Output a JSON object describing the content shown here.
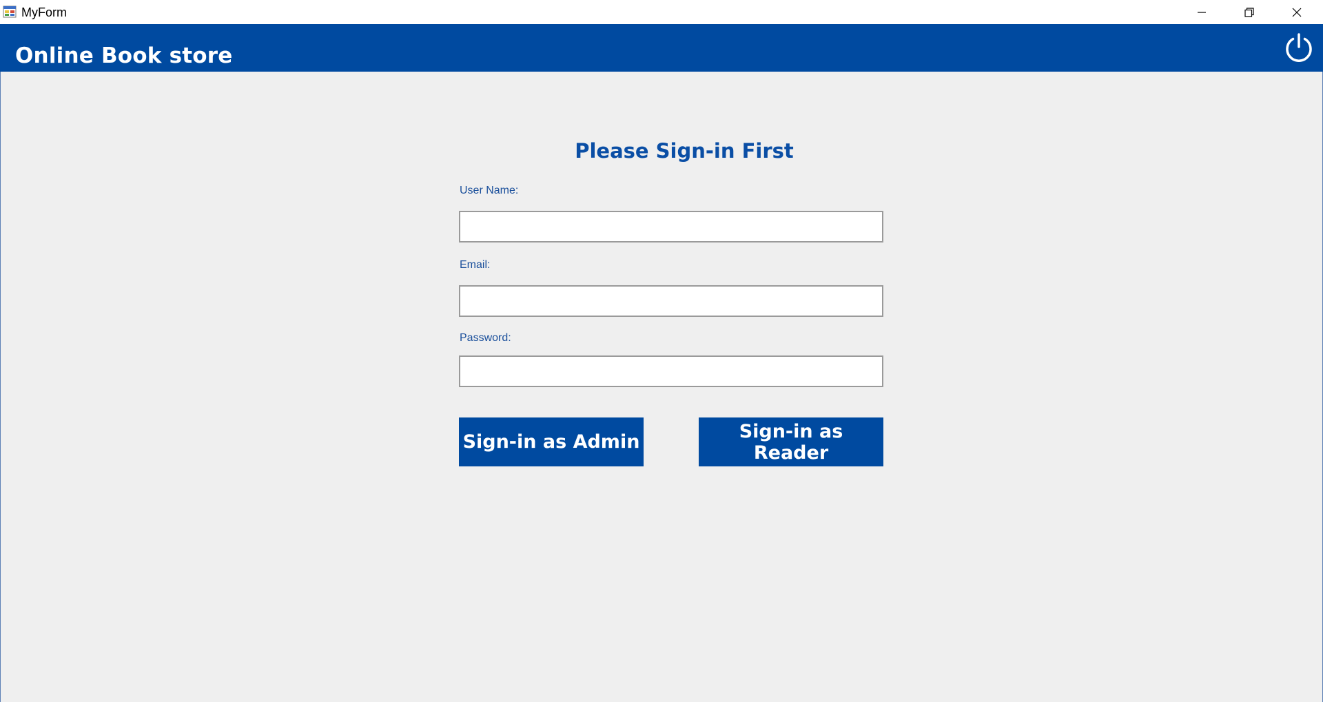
{
  "window": {
    "title": "MyForm",
    "icon": "windows-form-icon",
    "controls": {
      "minimize": "minimize-icon",
      "maximize": "restore-icon",
      "close": "close-icon"
    }
  },
  "header": {
    "title": "Online Book store",
    "power_icon": "power-icon",
    "background_color": "#004aa0"
  },
  "form": {
    "heading": "Please Sign-in First",
    "fields": [
      {
        "label": "User Name:",
        "value": "",
        "placeholder": ""
      },
      {
        "label": "Email:",
        "value": "",
        "placeholder": ""
      },
      {
        "label": "Password:",
        "value": "",
        "placeholder": ""
      }
    ],
    "buttons": {
      "admin": "Sign-in as Admin",
      "reader": "Sign-in as Reader"
    }
  },
  "colors": {
    "accent": "#004aa0",
    "label_text": "#1a4f9b",
    "background": "#efefef"
  }
}
